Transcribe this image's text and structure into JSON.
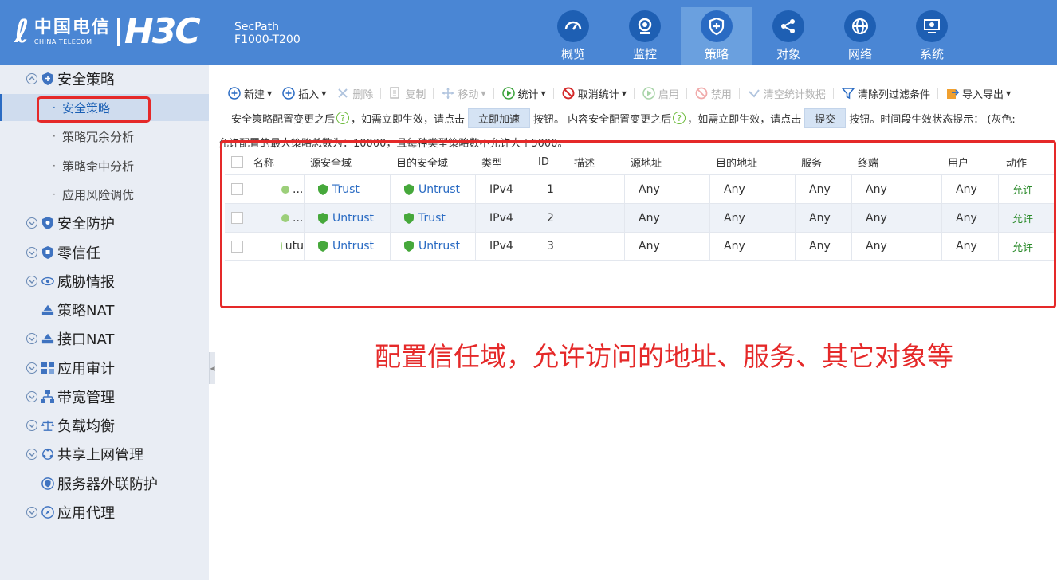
{
  "header": {
    "brand_cn": "中国电信",
    "brand_en": "CHINA TELECOM",
    "brand_h3c": "H3C",
    "product_line1": "SecPath",
    "product_line2": "F1000-T200",
    "nav": [
      {
        "label": "概览",
        "icon": "dashboard-icon"
      },
      {
        "label": "监控",
        "icon": "monitor-icon"
      },
      {
        "label": "策略",
        "icon": "policy-shield-icon",
        "active": true
      },
      {
        "label": "对象",
        "icon": "share-nodes-icon"
      },
      {
        "label": "网络",
        "icon": "globe-icon"
      },
      {
        "label": "系统",
        "icon": "system-monitor-icon"
      }
    ]
  },
  "sidebar": {
    "items": [
      {
        "label": "安全策略",
        "level": 1,
        "icon": "shield-icon"
      },
      {
        "label": "安全策略",
        "level": 2,
        "selected": true
      },
      {
        "label": "策略冗余分析",
        "level": 2
      },
      {
        "label": "策略命中分析",
        "level": 2
      },
      {
        "label": "应用风险调优",
        "level": 2
      },
      {
        "label": "安全防护",
        "level": 1,
        "icon": "shield-icon"
      },
      {
        "label": "零信任",
        "level": 1,
        "icon": "shield-icon"
      },
      {
        "label": "威胁情报",
        "level": 1,
        "icon": "eye-icon"
      },
      {
        "label": "策略NAT",
        "level": 1,
        "icon": "nat-icon"
      },
      {
        "label": "接口NAT",
        "level": 1,
        "icon": "nat-icon"
      },
      {
        "label": "应用审计",
        "level": 1,
        "icon": "grid-icon"
      },
      {
        "label": "带宽管理",
        "level": 1,
        "icon": "hierarchy-icon"
      },
      {
        "label": "负载均衡",
        "level": 1,
        "icon": "balance-icon"
      },
      {
        "label": "共享上网管理",
        "level": 1,
        "icon": "share-icon"
      },
      {
        "label": "服务器外联防护",
        "level": 1,
        "icon": "server-shield-icon"
      },
      {
        "label": "应用代理",
        "level": 1,
        "icon": "compass-icon"
      }
    ]
  },
  "toolbar": {
    "buttons": [
      {
        "label": "新建",
        "icon": "plus-circle-icon",
        "dropdown": true
      },
      {
        "label": "插入",
        "icon": "plus-circle-icon",
        "dropdown": true
      },
      {
        "label": "删除",
        "icon": "x-icon",
        "disabled": true
      },
      {
        "label": "复制",
        "icon": "copy-icon",
        "disabled": true
      },
      {
        "label": "移动",
        "icon": "move-icon",
        "dropdown": true,
        "disabled": true
      },
      {
        "label": "统计",
        "icon": "play-circle-icon",
        "dropdown": true
      },
      {
        "label": "取消统计",
        "icon": "no-entry-icon",
        "dropdown": true
      },
      {
        "label": "启用",
        "icon": "play-circle-icon",
        "disabled": true
      },
      {
        "label": "禁用",
        "icon": "ban-icon",
        "disabled": true
      },
      {
        "label": "清空统计数据",
        "icon": "eraser-icon",
        "disabled": true
      },
      {
        "label": "清除列过滤条件",
        "icon": "filter-icon"
      },
      {
        "label": "导入导出",
        "icon": "import-export-icon",
        "dropdown": true
      }
    ]
  },
  "notice": {
    "part1": "安全策略配置变更之后",
    "part2": "，如需立即生效，请点击",
    "button1": "立即加速",
    "part3": "按钮。 内容安全配置变更之后",
    "part4": "，如需立即生效，请点击",
    "button2": "提交",
    "part5": "按钮。时间段生效状态提示： (灰色:",
    "line2": "允许配置的最大策略总数为：10000，且每种类型策略数不允许大于5000。"
  },
  "table": {
    "columns": [
      "名称",
      "源安全域",
      "目的安全域",
      "类型",
      "ID",
      "描述",
      "源地址",
      "目的地址",
      "服务",
      "终端",
      "用户",
      "动作"
    ],
    "rows": [
      {
        "name": "...",
        "src_zone": "Trust",
        "dst_zone": "Untrust",
        "type": "IPv4",
        "id": "1",
        "desc": "",
        "src_addr": "Any",
        "dst_addr": "Any",
        "service": "Any",
        "terminal": "Any",
        "user": "Any",
        "action": "允许"
      },
      {
        "name": "...",
        "src_zone": "Untrust",
        "dst_zone": "Trust",
        "type": "IPv4",
        "id": "2",
        "desc": "",
        "src_addr": "Any",
        "dst_addr": "Any",
        "service": "Any",
        "terminal": "Any",
        "user": "Any",
        "action": "允许"
      },
      {
        "name": "utu",
        "src_zone": "Untrust",
        "dst_zone": "Untrust",
        "type": "IPv4",
        "id": "3",
        "desc": "",
        "src_addr": "Any",
        "dst_addr": "Any",
        "service": "Any",
        "terminal": "Any",
        "user": "Any",
        "action": "允许"
      }
    ]
  },
  "annotation": {
    "text": "配置信任域，允许访问的地址、服务、其它对象等",
    "color": "#e52929"
  },
  "colors": {
    "header_bg": "#4a86d4",
    "nav_active": "#6aa0df",
    "sidebar_bg": "#e9edf4",
    "link_blue": "#2a6bc3",
    "allow_green": "#2a8a2a"
  }
}
